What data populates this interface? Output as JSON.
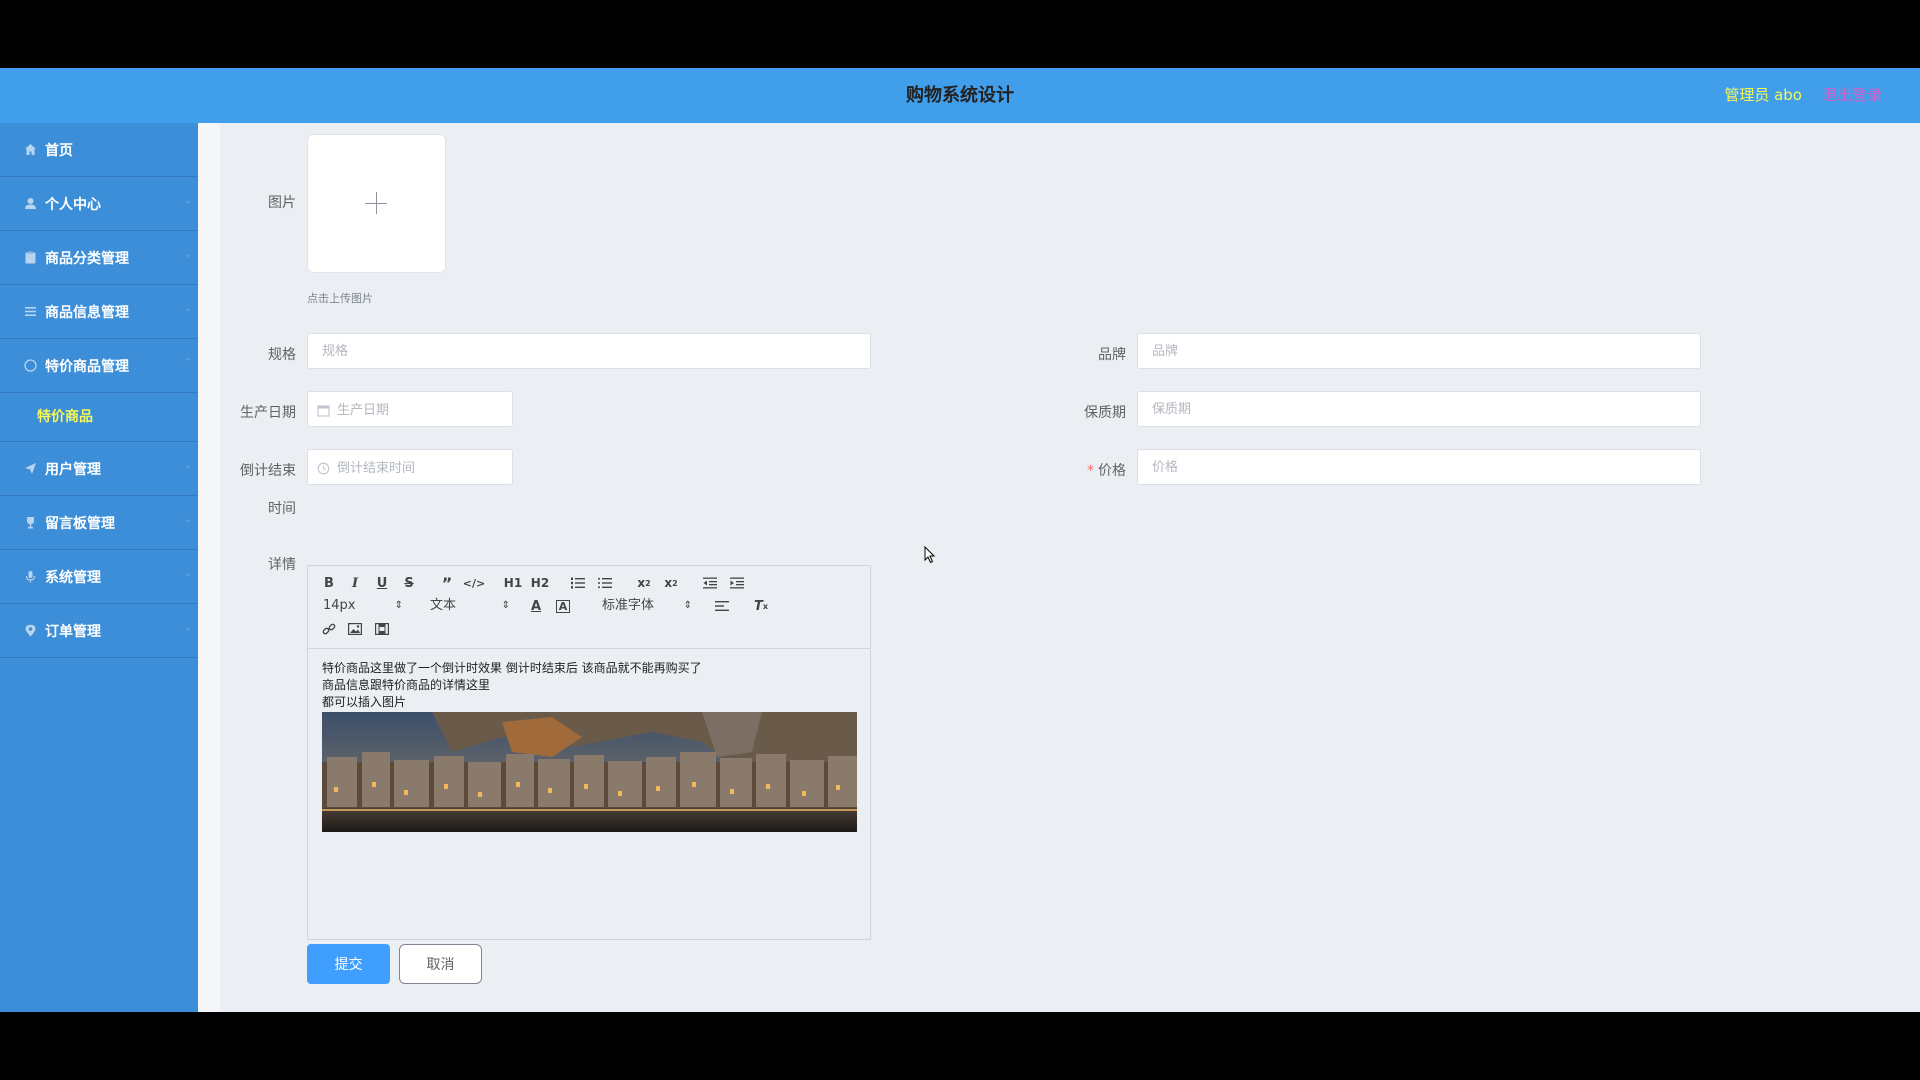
{
  "header": {
    "title": "购物系统设计",
    "admin": "管理员 abo",
    "logout": "退出登录"
  },
  "sidebar": {
    "items": [
      {
        "label": "首页",
        "icon": "home-icon"
      },
      {
        "label": "个人中心",
        "icon": "user-icon"
      },
      {
        "label": "商品分类管理",
        "icon": "clipboard-icon"
      },
      {
        "label": "商品信息管理",
        "icon": "list-icon"
      },
      {
        "label": "特价商品管理",
        "icon": "help-circle-icon"
      },
      {
        "label": "用户管理",
        "icon": "send-icon"
      },
      {
        "label": "留言板管理",
        "icon": "trophy-icon"
      },
      {
        "label": "系统管理",
        "icon": "microphone-icon"
      },
      {
        "label": "订单管理",
        "icon": "location-icon"
      }
    ],
    "submenu": {
      "label": "特价商品"
    }
  },
  "form": {
    "image_label": "图片",
    "upload_tip": "点击上传图片",
    "spec_label": "规格",
    "spec_placeholder": "规格",
    "brand_label": "品牌",
    "brand_placeholder": "品牌",
    "production_date_label": "生产日期",
    "production_date_placeholder": "生产日期",
    "shelf_life_label": "保质期",
    "shelf_life_placeholder": "保质期",
    "countdown_label_line1": "倒计结束",
    "countdown_label_line2": "时间",
    "countdown_placeholder": "倒计结束时间",
    "price_required": "*",
    "price_label": "价格",
    "price_placeholder": "价格",
    "detail_label": "详情"
  },
  "editor": {
    "font_size": "14px",
    "header_select": "文本",
    "font_family": "标准字体",
    "h1": "H1",
    "h2": "H2",
    "content_lines": [
      "特价商品这里做了一个倒计时效果  倒计时结束后  该商品就不能再购买了",
      "商品信息跟特价商品的详情这里",
      "都可以插入图片"
    ]
  },
  "buttons": {
    "submit": "提交",
    "cancel": "取消"
  }
}
